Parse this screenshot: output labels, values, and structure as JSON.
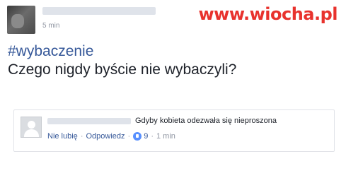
{
  "post": {
    "time": "5 min",
    "hashtag": "#wybaczenie",
    "text": "Czego nigdy byście nie wybaczyli?"
  },
  "watermark": "www.wiocha.pl",
  "comment": {
    "text": "Gdyby kobieta odezwała się nieproszona",
    "like_label": "Nie lubię",
    "reply_label": "Odpowiedz",
    "like_count": "9",
    "time": "1 min",
    "separator": "·",
    "like_icon": "thumbs-up-icon"
  },
  "colors": {
    "link": "#365899",
    "watermark": "#e8322d",
    "meta": "#9197a3"
  }
}
